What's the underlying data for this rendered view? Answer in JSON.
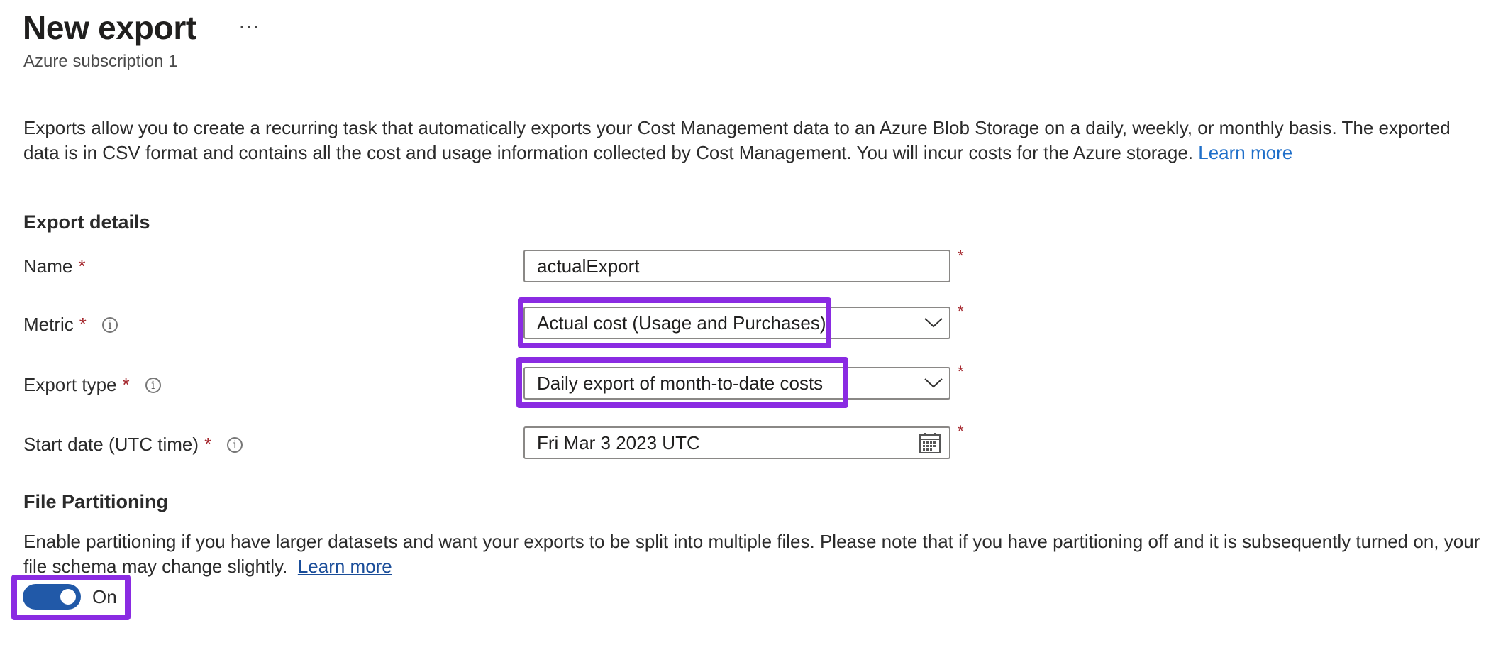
{
  "header": {
    "title": "New export",
    "more_icon": "ellipsis-icon",
    "subtitle": "Azure subscription 1"
  },
  "description": {
    "text": "Exports allow you to create a recurring task that automatically exports your Cost Management data to an Azure Blob Storage on a daily, weekly, or monthly basis. The exported data is in CSV format and contains all the cost and usage information collected by Cost Management. You will incur costs for the Azure storage.",
    "link": "Learn more"
  },
  "export_details": {
    "heading": "Export details",
    "name": {
      "label": "Name",
      "required": "*",
      "value": "actualExport"
    },
    "metric": {
      "label": "Metric",
      "required": "*",
      "value": "Actual cost (Usage and Purchases)"
    },
    "export_type": {
      "label": "Export type",
      "required": "*",
      "value": "Daily export of month-to-date costs"
    },
    "start_date": {
      "label": "Start date (UTC time)",
      "required": "*",
      "value": "Fri Mar 3 2023 UTC"
    }
  },
  "file_partitioning": {
    "heading": "File Partitioning",
    "text": "Enable partitioning if you have larger datasets and want your exports to be split into multiple files. Please note that if you have partitioning off and it is subsequently turned on, your file schema may change slightly.",
    "link": "Learn more",
    "toggle_label": "On",
    "toggle_on": true
  },
  "colors": {
    "accent_highlight": "#8a2be2",
    "toggle_on": "#2159a8",
    "link": "#1f6fc9",
    "required": "#a4262c"
  }
}
